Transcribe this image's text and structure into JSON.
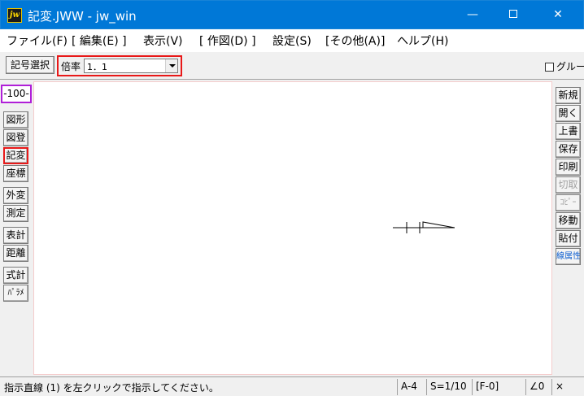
{
  "window": {
    "title": "記変.JWW - jw_win",
    "app_icon_text": "jw",
    "colors": {
      "titlebar": "#0078d7",
      "highlight": "#e81818",
      "layer_frame": "#b01fd8"
    }
  },
  "menu": [
    "ファイル(F)",
    "[ 編集(E) ]",
    "表示(V)",
    "[ 作図(D) ]",
    "設定(S)",
    "[その他(A)]",
    "ヘルプ(H)"
  ],
  "toolbar": {
    "symbol_select_label": "記号選択",
    "scale_label": "倍率",
    "scale_value": "1．1",
    "checkbox_label": "グルー"
  },
  "left_tools": {
    "layer_indicator": "-100-",
    "buttons": [
      "図形",
      "図登",
      "記変",
      "座標",
      "外変",
      "測定",
      "表計",
      "距離",
      "式計",
      "ﾊﾟﾗﾒ"
    ]
  },
  "right_tools": {
    "buttons": [
      "新規",
      "開く",
      "上書",
      "保存",
      "印刷",
      "切取",
      "ｺﾋﾟｰ",
      "移動",
      "貼付",
      "線属性"
    ]
  },
  "status": {
    "message": "指示直線 (1) を左クリックで指示してください。",
    "paper": "A-4",
    "scale": "S=1/10",
    "layer": "[F-0]",
    "angle": "∠0",
    "zoom": "×"
  }
}
